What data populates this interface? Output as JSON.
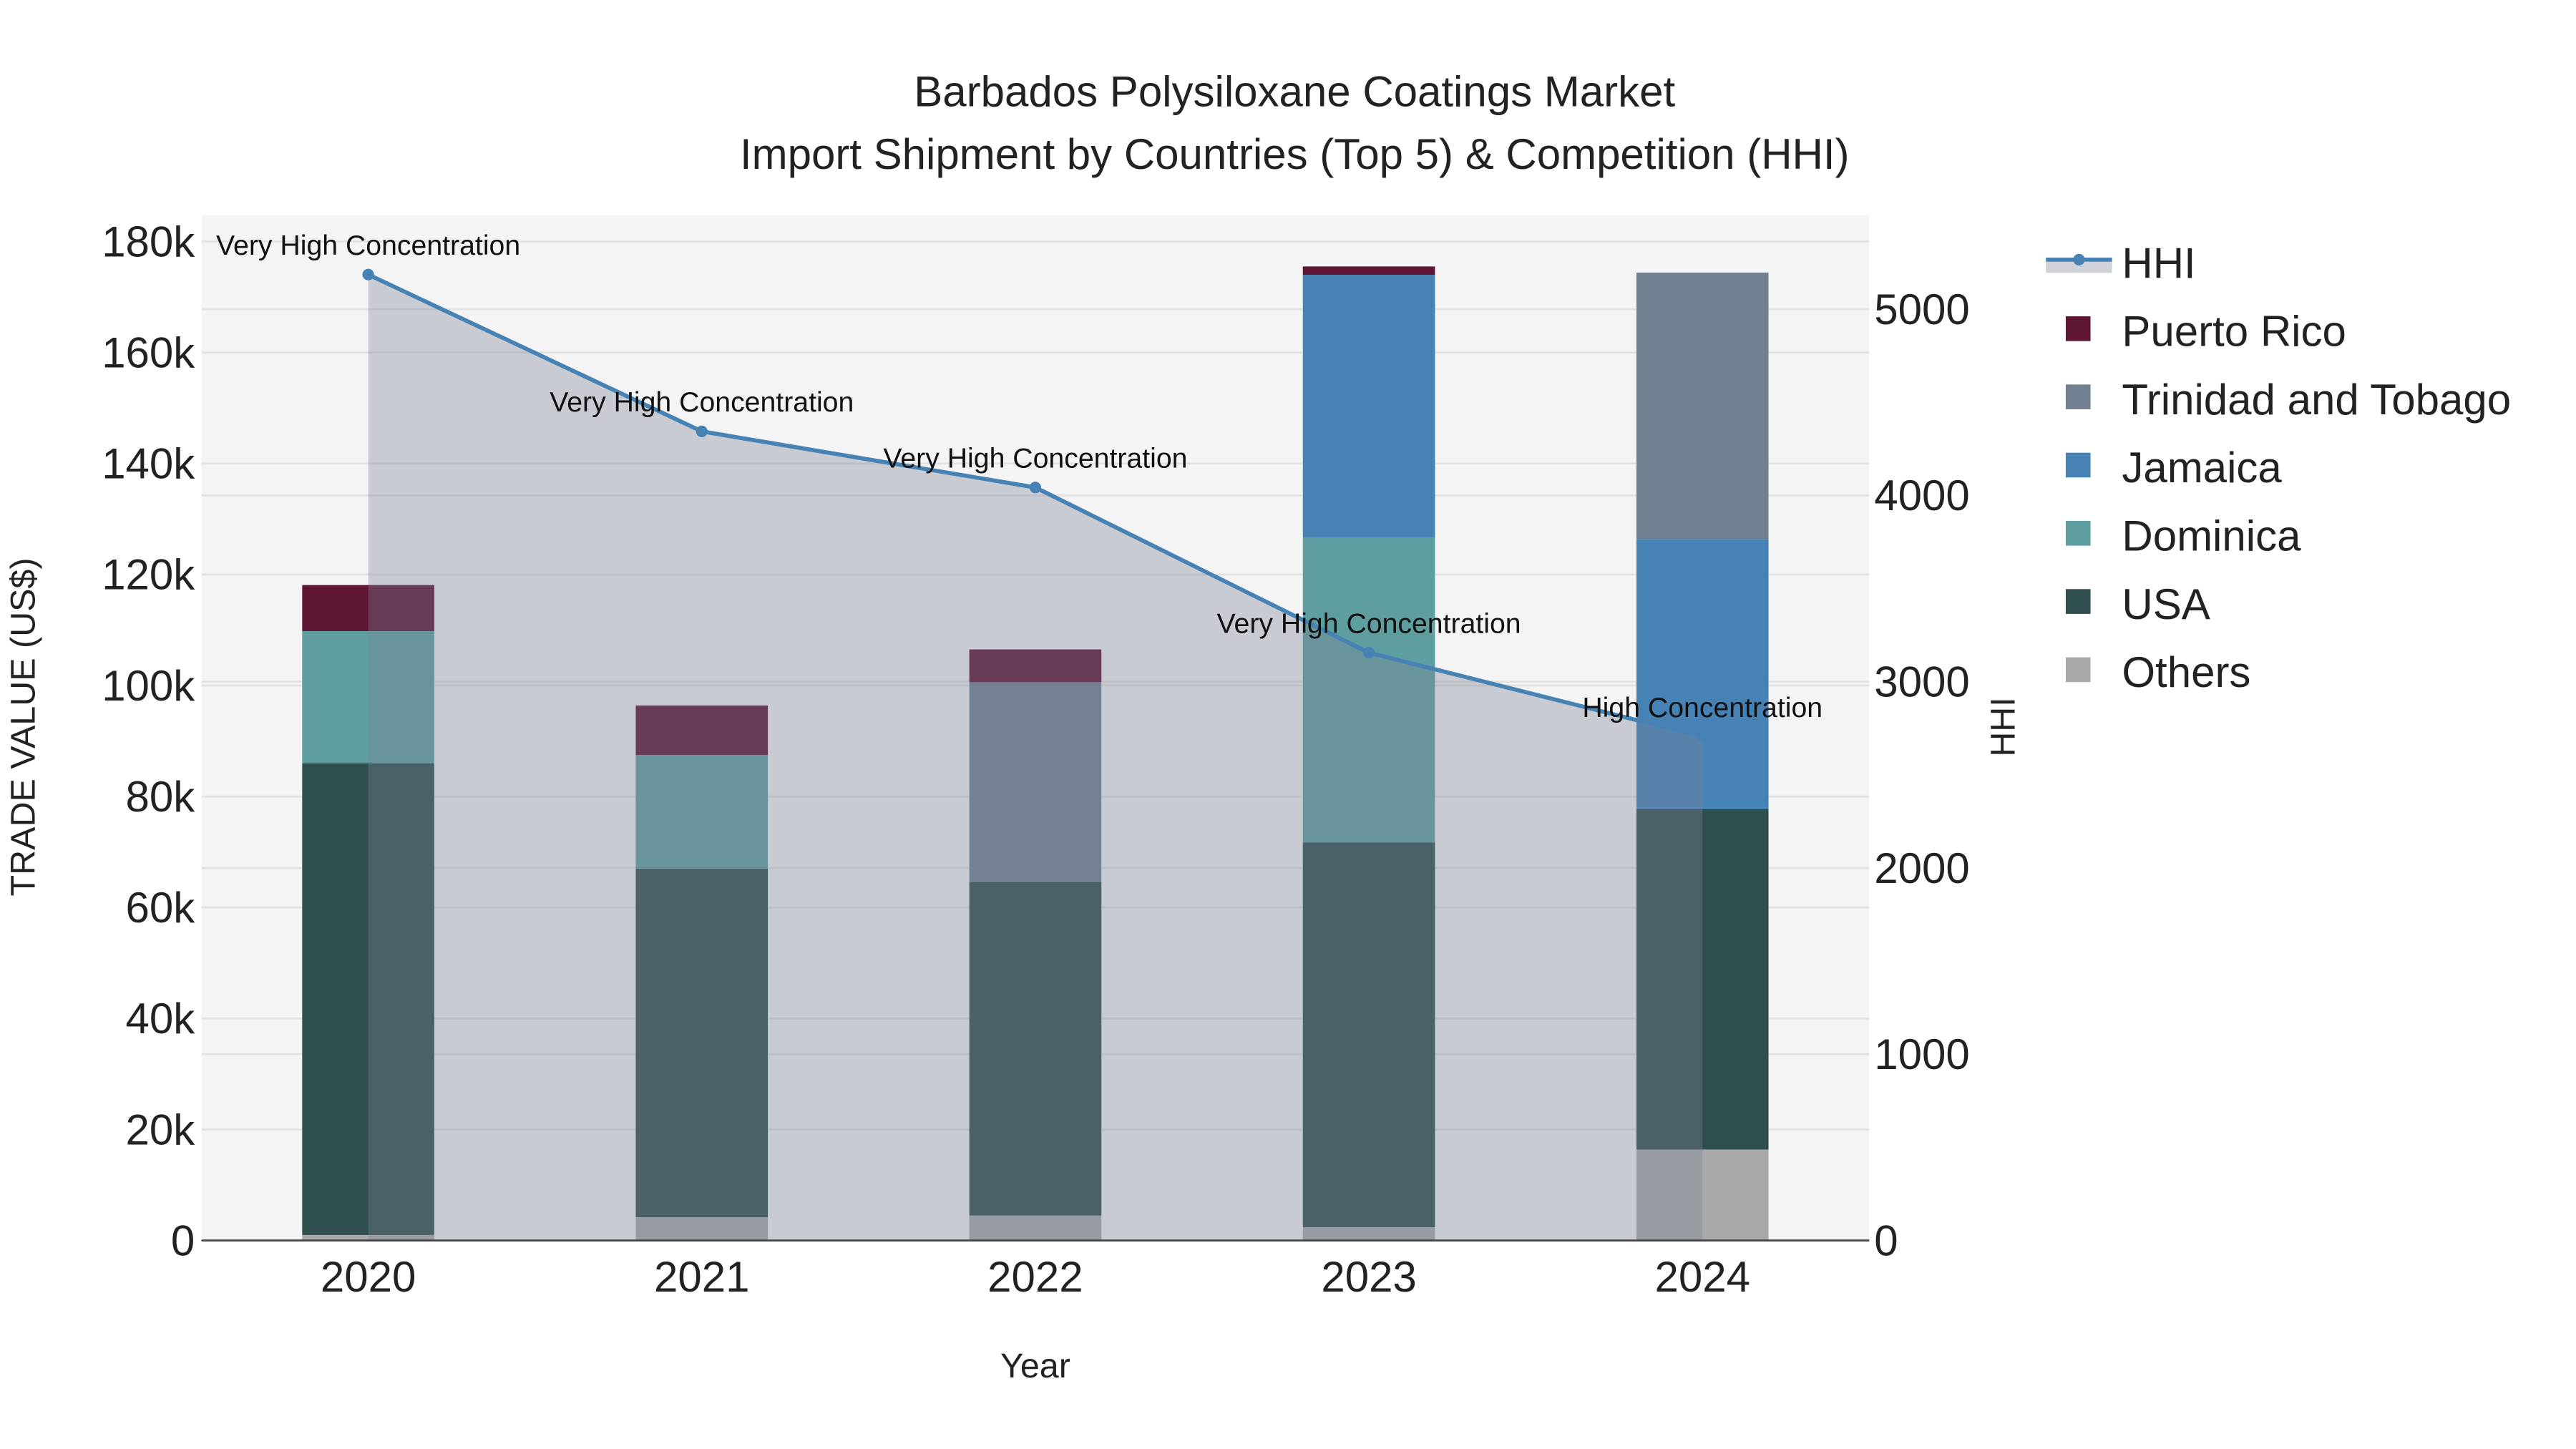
{
  "chart_data": {
    "type": "bar",
    "title": "Barbados Polysiloxane Coatings Market",
    "subtitle": "Import Shipment by Countries (Top 5) & Competition (HHI)",
    "xlabel": "Year",
    "ylabel": "TRADE VALUE (US$)",
    "y2label": "HHI",
    "categories": [
      "2020",
      "2021",
      "2022",
      "2023",
      "2024"
    ],
    "ylim": [
      0,
      180000
    ],
    "y2lim": [
      0,
      5400
    ],
    "yticks": [
      0,
      20000,
      40000,
      60000,
      80000,
      100000,
      120000,
      140000,
      160000,
      180000
    ],
    "ytick_labels": [
      "0",
      "20k",
      "40k",
      "60k",
      "80k",
      "100k",
      "120k",
      "140k",
      "160k",
      "180k"
    ],
    "y2ticks": [
      0,
      1000,
      2000,
      3000,
      4000,
      5000
    ],
    "y2tick_labels": [
      "0",
      "1000",
      "2000",
      "3000",
      "4000",
      "5000"
    ],
    "barmode": "stack",
    "series": [
      {
        "name": "Others",
        "color": "#a9a9a9",
        "values": [
          1000,
          4200,
          4500,
          2400,
          16400
        ]
      },
      {
        "name": "USA",
        "color": "#2f4f4f",
        "values": [
          85000,
          62800,
          60100,
          69300,
          61300
        ]
      },
      {
        "name": "Dominica",
        "color": "#5f9ea0",
        "values": [
          23800,
          20500,
          0,
          55000,
          0
        ]
      },
      {
        "name": "Jamaica",
        "color": "#4682b4",
        "values": [
          0,
          0,
          0,
          47300,
          48700
        ]
      },
      {
        "name": "Trinidad and Tobago",
        "color": "#708090",
        "values": [
          0,
          0,
          36000,
          0,
          48000
        ]
      },
      {
        "name": "Puerto Rico",
        "color": "#5f1534",
        "values": [
          8300,
          8900,
          5900,
          1500,
          0
        ]
      }
    ],
    "hhi": {
      "name": "HHI",
      "color": "#4682b4",
      "values": [
        5186,
        4344,
        4043,
        3156,
        2705
      ],
      "annotations": [
        "Very High Concentration",
        "Very High Concentration",
        "Very High Concentration",
        "Very High Concentration",
        "High Concentration"
      ]
    },
    "legend_order": [
      "HHI",
      "Puerto Rico",
      "Trinidad and Tobago",
      "Jamaica",
      "Dominica",
      "USA",
      "Others"
    ],
    "legend_position": "right",
    "grid": true
  }
}
